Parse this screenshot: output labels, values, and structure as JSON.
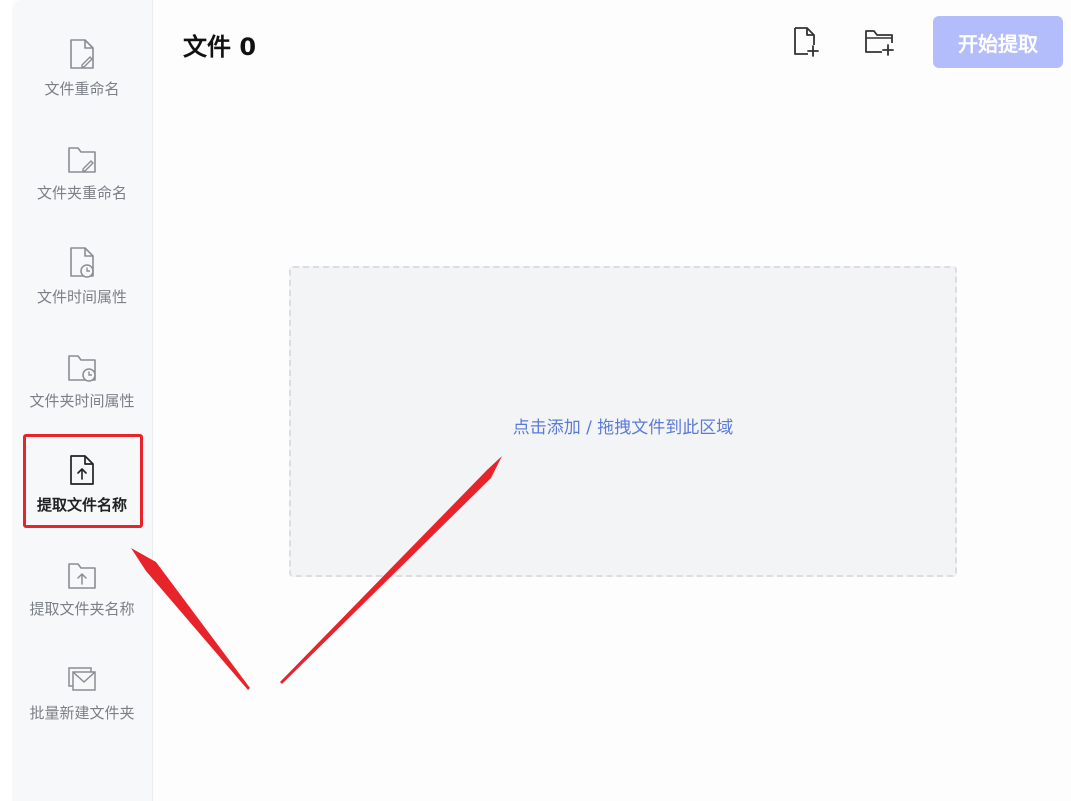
{
  "header": {
    "title": "文件 0",
    "start_label": "开始提取"
  },
  "sidebar": {
    "items": [
      {
        "label": "文件重命名",
        "icon": "file-edit-icon"
      },
      {
        "label": "文件夹重命名",
        "icon": "folder-edit-icon"
      },
      {
        "label": "文件时间属性",
        "icon": "file-clock-icon"
      },
      {
        "label": "文件夹时间属性",
        "icon": "folder-clock-icon"
      },
      {
        "label": "提取文件名称",
        "icon": "file-upload-icon",
        "active": true
      },
      {
        "label": "提取文件夹名称",
        "icon": "folder-upload-icon"
      },
      {
        "label": "批量新建文件夹",
        "icon": "batch-folder-icon"
      }
    ]
  },
  "dropzone": {
    "text": "点击添加 / 拖拽文件到此区域"
  },
  "colors": {
    "accent": "#5b7bd8",
    "start_button_disabled": "#b4bdfb",
    "annotation": "#e8242a"
  }
}
